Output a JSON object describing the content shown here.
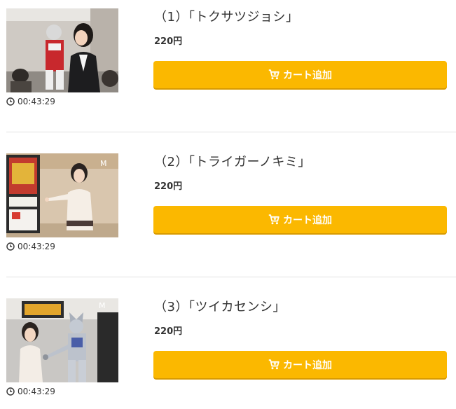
{
  "episodes": [
    {
      "title": "（1）「トクサツジョシ」",
      "price": "220円",
      "cart_label": "カート追加",
      "duration": "00:43:29",
      "thumbnail": "thumbnail-woman-in-train-with-red-hero"
    },
    {
      "title": "（2）「トライガーノキミ」",
      "price": "220円",
      "cart_label": "カート追加",
      "duration": "00:43:29",
      "thumbnail": "thumbnail-woman-pointing-by-hero-poster"
    },
    {
      "title": "（3）「ツイカセンシ」",
      "price": "220円",
      "cart_label": "カート追加",
      "duration": "00:43:29",
      "thumbnail": "thumbnail-woman-shaking-hands-with-silver-hero"
    }
  ],
  "colors": {
    "button": "#fbb800",
    "button_shadow": "#d89a00",
    "divider": "#e2e2e2"
  },
  "icons": {
    "cart": "cart-icon",
    "clock": "clock-icon"
  }
}
